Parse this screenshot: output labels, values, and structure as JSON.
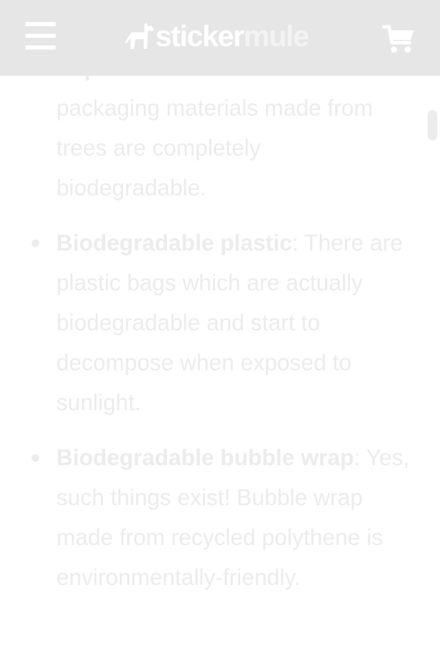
{
  "header": {
    "logo_part1": "sticker",
    "logo_part2": "mule"
  },
  "content": {
    "first_item": {
      "term": "Paper and cardboard",
      "text": ": Trees packaging materials made from trees are completely biodegradable."
    },
    "items": [
      {
        "term": "Biodegradable plastic",
        "text": ": There are plastic bags which are actually biodegradable and start to decompose when exposed to sunlight."
      },
      {
        "term": "Biodegradable bubble wrap",
        "text": ": Yes, such things exist! Bubble wrap made from recycled polythene is environmentally-friendly."
      }
    ]
  },
  "colors": {
    "header_bg": "#e6e6e6",
    "text": "#ececec",
    "logo_white": "#ffffff"
  },
  "icons": {
    "menu": "hamburger-menu-icon",
    "logo": "mule-icon",
    "cart": "shopping-cart-icon"
  }
}
